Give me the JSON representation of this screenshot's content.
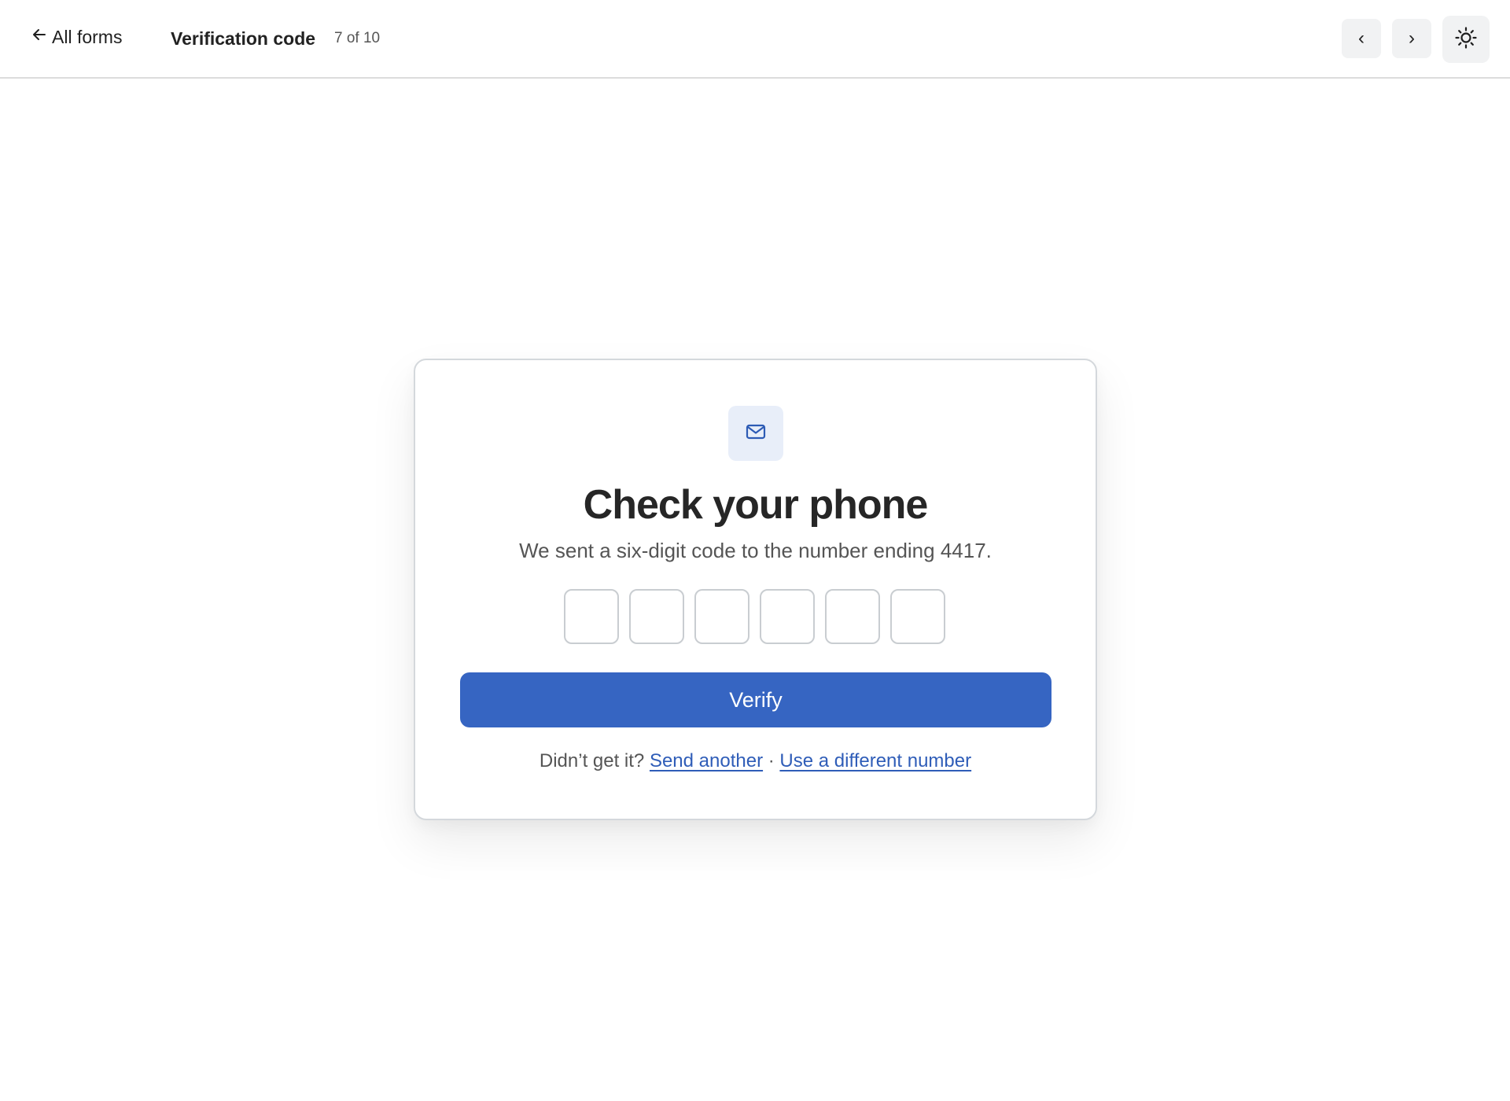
{
  "header": {
    "back_label": "All forms",
    "form_title": "Verification code",
    "counter": "7 of 10",
    "prev_label": "‹",
    "next_label": "›"
  },
  "card": {
    "icon": "mail-icon",
    "title": "Check your phone",
    "subtitle": "We sent a six-digit code to the number ending 4417.",
    "code_digits": [
      "",
      "",
      "",
      "",
      "",
      ""
    ],
    "verify_label": "Verify",
    "resend_prompt": "Didn’t get it?",
    "send_another_label": "Send another",
    "separator": "·",
    "different_number_label": "Use a different number"
  },
  "colors": {
    "accent": "#3665c2",
    "link": "#2f5db8",
    "icon_tile": "#e8eef9"
  }
}
